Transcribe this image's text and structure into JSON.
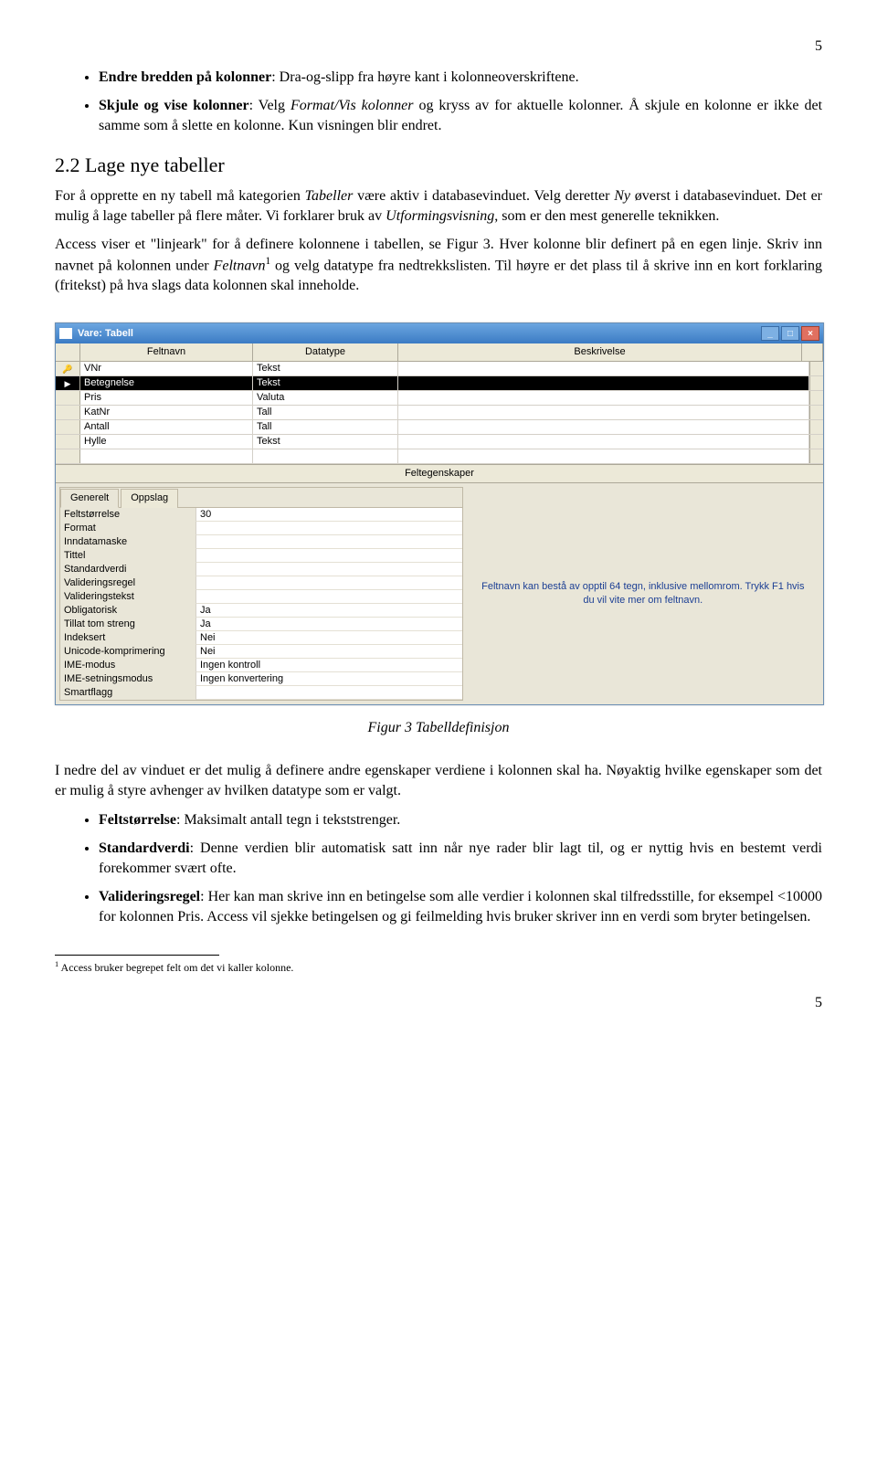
{
  "page_number_top": "5",
  "page_number_bottom": "5",
  "bullets_top": [
    {
      "label": "Endre bredden på kolonner",
      "text": ": Dra-og-slipp fra høyre kant i kolonneoverskriftene."
    },
    {
      "label": "Skjule og vise kolonner",
      "text_before": ": Velg ",
      "italic1": "Format/Vis kolonner",
      "text_mid": " og kryss av for aktuelle kolonner. Å skjule en kolonne er ikke det samme som å slette en kolonne. Kun visningen blir endret."
    }
  ],
  "heading": "2.2 Lage nye tabeller",
  "para1_a": "For å opprette en ny tabell må kategorien ",
  "para1_i1": "Tabeller",
  "para1_b": " være aktiv i databasevinduet. Velg deretter ",
  "para1_i2": "Ny",
  "para1_c": " øverst i databasevinduet. Det er mulig å lage tabeller på flere måter. Vi forklarer bruk av ",
  "para1_i3": "Utformingsvisning",
  "para1_d": ", som er den mest generelle teknikken.",
  "para2_a": "Access viser et \"linjeark\" for å definere kolonnene i tabellen, se Figur 3. Hver kolonne blir definert på en egen linje. Skriv inn navnet på kolonnen under ",
  "para2_i1": "Feltnavn",
  "para2_sup": "1",
  "para2_b": " og velg datatype fra nedtrekkslisten. Til høyre er det plass til å skrive inn en kort forklaring (fritekst) på hva slags data kolonnen skal inneholde.",
  "access": {
    "title": "Vare: Tabell",
    "headers": {
      "feltnavn": "Feltnavn",
      "datatype": "Datatype",
      "beskrivelse": "Beskrivelse"
    },
    "rows": [
      {
        "sel": "key",
        "fn": "VNr",
        "dt": "Tekst"
      },
      {
        "sel": "cursor",
        "fn": "Betegnelse",
        "dt": "Tekst",
        "selected": true
      },
      {
        "sel": "",
        "fn": "Pris",
        "dt": "Valuta"
      },
      {
        "sel": "",
        "fn": "KatNr",
        "dt": "Tall"
      },
      {
        "sel": "",
        "fn": "Antall",
        "dt": "Tall"
      },
      {
        "sel": "",
        "fn": "Hylle",
        "dt": "Tekst"
      },
      {
        "sel": "",
        "fn": "",
        "dt": ""
      }
    ],
    "feprops_title": "Feltegenskaper",
    "tabs": {
      "generelt": "Generelt",
      "oppslag": "Oppslag"
    },
    "props": [
      {
        "label": "Feltstørrelse",
        "value": "30"
      },
      {
        "label": "Format",
        "value": ""
      },
      {
        "label": "Inndatamaske",
        "value": ""
      },
      {
        "label": "Tittel",
        "value": ""
      },
      {
        "label": "Standardverdi",
        "value": ""
      },
      {
        "label": "Valideringsregel",
        "value": ""
      },
      {
        "label": "Valideringstekst",
        "value": ""
      },
      {
        "label": "Obligatorisk",
        "value": "Ja"
      },
      {
        "label": "Tillat tom streng",
        "value": "Ja"
      },
      {
        "label": "Indeksert",
        "value": "Nei"
      },
      {
        "label": "Unicode-komprimering",
        "value": "Nei"
      },
      {
        "label": "IME-modus",
        "value": "Ingen kontroll"
      },
      {
        "label": "IME-setningsmodus",
        "value": "Ingen konvertering"
      },
      {
        "label": "Smartflagg",
        "value": ""
      }
    ],
    "hint": "Feltnavn kan bestå av opptil 64 tegn, inklusive mellomrom. Trykk F1 hvis du vil vite mer om feltnavn."
  },
  "figure_caption": "Figur 3  Tabelldefinisjon",
  "para3": "I nedre del av vinduet er det mulig å definere andre egenskaper verdiene i kolonnen skal ha. Nøyaktig hvilke egenskaper som det er mulig å styre avhenger av hvilken datatype som er valgt.",
  "bullets_bottom": [
    {
      "label": "Feltstørrelse",
      "text": ": Maksimalt antall tegn i tekststrenger."
    },
    {
      "label": "Standardverdi",
      "text": ": Denne verdien blir automatisk satt inn når nye rader blir lagt til, og er nyttig hvis en bestemt verdi forekommer svært ofte."
    },
    {
      "label": "Valideringsregel",
      "text": ": Her kan man skrive inn en betingelse som alle verdier i kolonnen skal tilfredsstille, for eksempel <10000 for kolonnen Pris. Access vil sjekke betingelsen og gi feilmelding hvis bruker skriver inn en verdi som bryter betingelsen."
    }
  ],
  "footnote_marker": "1",
  "footnote_text": " Access bruker begrepet felt om det vi kaller kolonne."
}
